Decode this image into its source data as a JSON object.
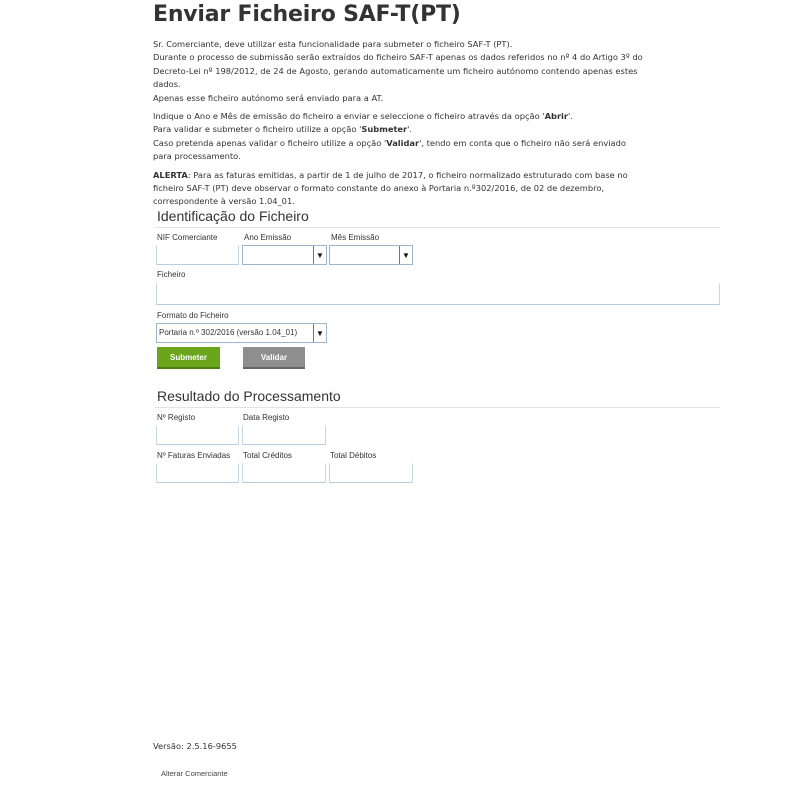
{
  "page": {
    "title": "Enviar Ficheiro SAF-T(PT)"
  },
  "intro": {
    "p1": [
      "Sr. Comerciante, deve utilizar esta funcionalidade para submeter o ficheiro SAF-T (PT).",
      "Durante o processo de submissão serão extraídos do ficheiro SAF-T apenas os dados referidos no nº 4 do Artigo 3º do Decreto-Lei nº 198/2012, de 24 de Agosto, gerando automaticamente um ficheiro autónomo contendo apenas estes dados.",
      "Apenas esse ficheiro autónomo será enviado para a AT."
    ],
    "p2_line1_pre": "Indique o Ano e Mês de emissão do ficheiro a enviar e seleccione o ficheiro através da opção '",
    "p2_line1_bold": "Abrir",
    "p2_line1_post": "'.",
    "p2_line2_pre": "Para validar e submeter o ficheiro utilize a opção '",
    "p2_line2_bold": "Submeter",
    "p2_line2_post": "'.",
    "p2_line3_pre": "Caso pretenda apenas validar o ficheiro utilize a opção '",
    "p2_line3_bold": "Validar",
    "p2_line3_post": "', tendo em conta que o ficheiro não será enviado para processamento.",
    "alert_label": "ALERTA",
    "alert_text": ": Para as faturas emitidas, a partir de 1 de julho de 2017, o ficheiro normalizado estruturado com base no ficheiro SAF-T (PT) deve observar o formato constante do anexo à Portaria n.º302/2016, de 02 de dezembro, correspondente à versão 1.04_01."
  },
  "identification": {
    "title": "Identificação do Ficheiro",
    "nif_label": "NIF Comerciante",
    "nif_value": "",
    "year_label": "Ano Emissão",
    "year_value": "",
    "month_label": "Mês Emissão",
    "month_value": "",
    "file_label": "Ficheiro",
    "file_value": "",
    "format_label": "Formato do Ficheiro",
    "format_value": "Portaria n.º 302/2016 (versão 1.04_01)",
    "submit_label": "Submeter",
    "validate_label": "Validar"
  },
  "result": {
    "title": "Resultado do Processamento",
    "reg_no_label": "Nº Registo",
    "reg_date_label": "Data Registo",
    "invoices_label": "Nº Faturas Enviadas",
    "credits_label": "Total Créditos",
    "debits_label": "Total Débitos"
  },
  "footer": {
    "version": "Versão: 2.5.16-9655",
    "change_merchant": "Alterar Comerciante"
  },
  "icons": {
    "dropdown": "chevron-down-icon"
  },
  "colors": {
    "submit": "#6aa51c",
    "validate": "#8e8e8e"
  }
}
